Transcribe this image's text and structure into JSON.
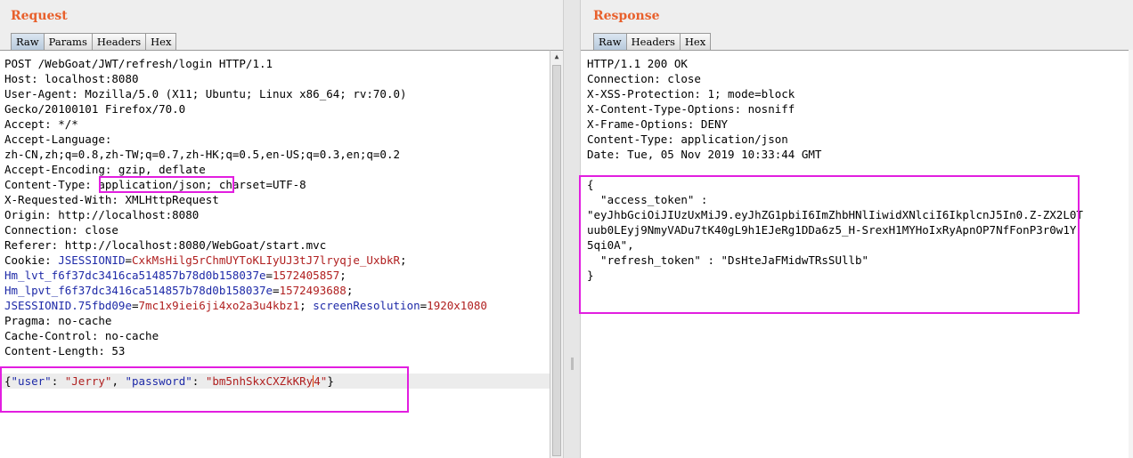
{
  "request": {
    "title": "Request",
    "tabs": [
      "Raw",
      "Params",
      "Headers",
      "Hex"
    ],
    "lines": [
      "POST /WebGoat/JWT/refresh/login HTTP/1.1",
      "Host: localhost:8080",
      "User-Agent: Mozilla/5.0 (X11; Ubuntu; Linux x86_64; rv:70.0)",
      "Gecko/20100101 Firefox/70.0",
      "Accept: */*",
      "Accept-Language:",
      "zh-CN,zh;q=0.8,zh-TW;q=0.7,zh-HK;q=0.5,en-US;q=0.3,en;q=0.2",
      "Accept-Encoding: gzip, deflate",
      "Content-Type: application/json; charset=UTF-8",
      "X-Requested-With: XMLHttpRequest",
      "Origin: http://localhost:8080",
      "Connection: close",
      "Referer: http://localhost:8080/WebGoat/start.mvc"
    ],
    "cookie_label": "Cookie: ",
    "cookies": [
      {
        "name": "JSESSIONID",
        "eq": "=",
        "value": "CxkMsHilg5rChmUYToKLIyUJ3tJ7lryqje_UxbkR",
        "sep": ";"
      },
      {
        "name": "Hm_lvt_f6f37dc3416ca514857b78d0b158037e",
        "eq": "=",
        "value": "1572405857",
        "sep": ";"
      },
      {
        "name": "Hm_lpvt_f6f37dc3416ca514857b78d0b158037e",
        "eq": "=",
        "value": "1572493688",
        "sep": ";"
      },
      {
        "name": "JSESSIONID.75fbd09e",
        "eq": "=",
        "value": "7mc1x9iei6ji4xo2a3u4kbz1",
        "sep": "; ",
        "name2": "screenResolution",
        "eq2": "=",
        "value2": "1920x1080"
      }
    ],
    "lines_after": [
      "Pragma: no-cache",
      "Cache-Control: no-cache",
      "Content-Length: 53"
    ],
    "body": {
      "open": "{",
      "user_key": "\"user\"",
      "colon1": ": ",
      "user_val": "\"Jerry\"",
      "comma": ", ",
      "pass_key": "\"password\"",
      "colon2": ": ",
      "pass_val_a": "\"bm5nhSkxCXZkKRy",
      "pass_val_b": "4\"",
      "close": "}"
    }
  },
  "response": {
    "title": "Response",
    "tabs": [
      "Raw",
      "Headers",
      "Hex"
    ],
    "lines": [
      "HTTP/1.1 200 OK",
      "Connection: close",
      "X-XSS-Protection: 1; mode=block",
      "X-Content-Type-Options: nosniff",
      "X-Frame-Options: DENY",
      "Content-Type: application/json",
      "Date: Tue, 05 Nov 2019 10:33:44 GMT",
      "",
      "{",
      "  \"access_token\" :",
      "\"eyJhbGciOiJIUzUxMiJ9.eyJhZG1pbiI6ImZhbHNlIiwidXNlciI6IkplcnJ5In0.Z-ZX2L0T",
      "uub0LEyj9NmyVADu7tK40gL9h1EJeRg1DDa6z5_H-SrexH1MYHoIxRyApnOP7NfFonP3r0w1Y",
      "5qi0A\",",
      "  \"refresh_token\" : \"DsHteJaFMidwTRsSUllb\"",
      "}"
    ]
  }
}
